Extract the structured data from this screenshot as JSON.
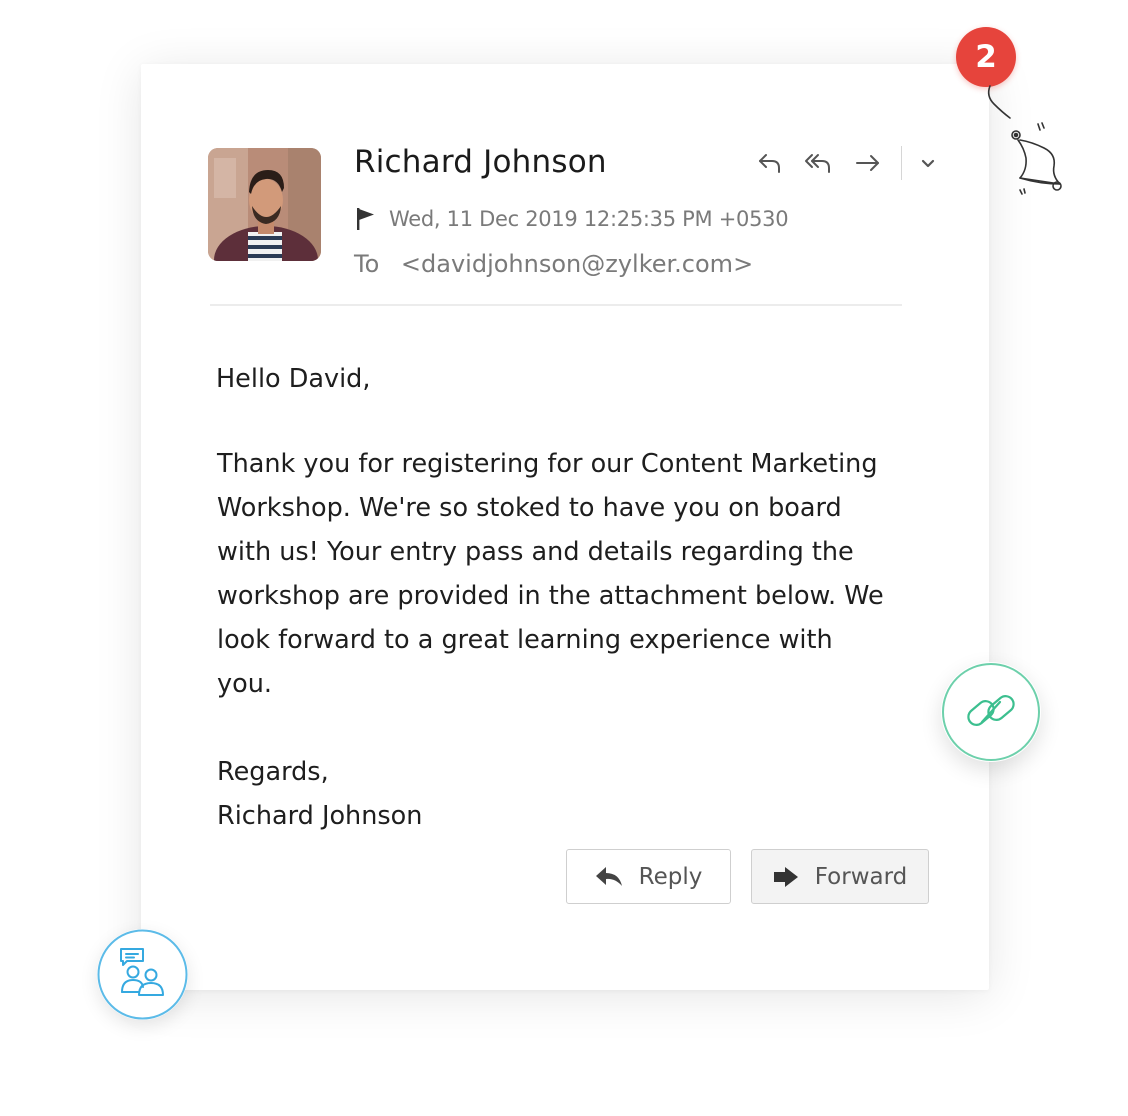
{
  "notification": {
    "count": "2"
  },
  "email": {
    "sender_name": "Richard Johnson",
    "date": "Wed, 11 Dec 2019 12:25:35 PM +0530",
    "to_label": "To",
    "to_address": "<davidjohnson@zylker.com>",
    "greeting": "Hello David,",
    "body_lines": [
      "Thank you for registering for our Content Marketing",
      "Workshop. We're so stoked to have you on board",
      "with us! Your entry pass and details regarding the",
      "workshop are provided in the attachment below. We",
      "look forward to a great learning experience with",
      "you."
    ],
    "signoff": "Regards,",
    "signature": "Richard Johnson"
  },
  "buttons": {
    "reply_label": "Reply",
    "forward_label": "Forward"
  },
  "icons": {
    "toolbar": [
      "reply-icon",
      "reply-all-icon",
      "forward-icon",
      "chevron-down-icon"
    ],
    "flag": "flag-icon",
    "bell": "bell-icon",
    "link": "link-icon",
    "people": "people-chat-icon"
  },
  "colors": {
    "badge": "#e6443c",
    "link_accent": "#3cbf8f",
    "people_accent": "#35a9e0"
  }
}
